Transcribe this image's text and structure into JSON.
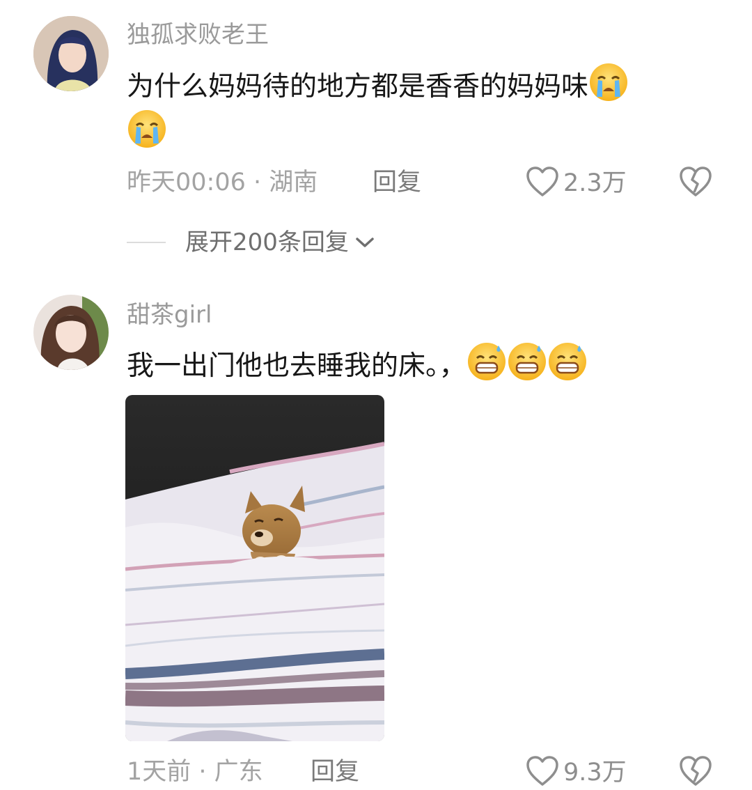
{
  "comments": [
    {
      "username": "独孤求败老王",
      "text": "为什么妈妈待的地方都是香香的妈妈味",
      "emoji": "loudly-crying-face",
      "time": "昨天00:06",
      "separator": " · ",
      "location": "湖南",
      "reply_label": "回复",
      "likes": "2.3万",
      "expand_label": "展开200条回复"
    },
    {
      "username": "甜茶girl",
      "text": "我一出门他也去睡我的床。，",
      "emoji": "grinning-sweat-face",
      "emoji_count": 3,
      "image": "puppy-sleeping-under-striped-blanket",
      "time": "1天前",
      "separator": " · ",
      "location": "广东",
      "reply_label": "回复",
      "likes": "9.3万"
    }
  ],
  "colors": {
    "username": "#9a9a9a",
    "text": "#171717",
    "meta": "#a3a3a3",
    "icon": "#8e8e8e",
    "background": "#ffffff"
  }
}
